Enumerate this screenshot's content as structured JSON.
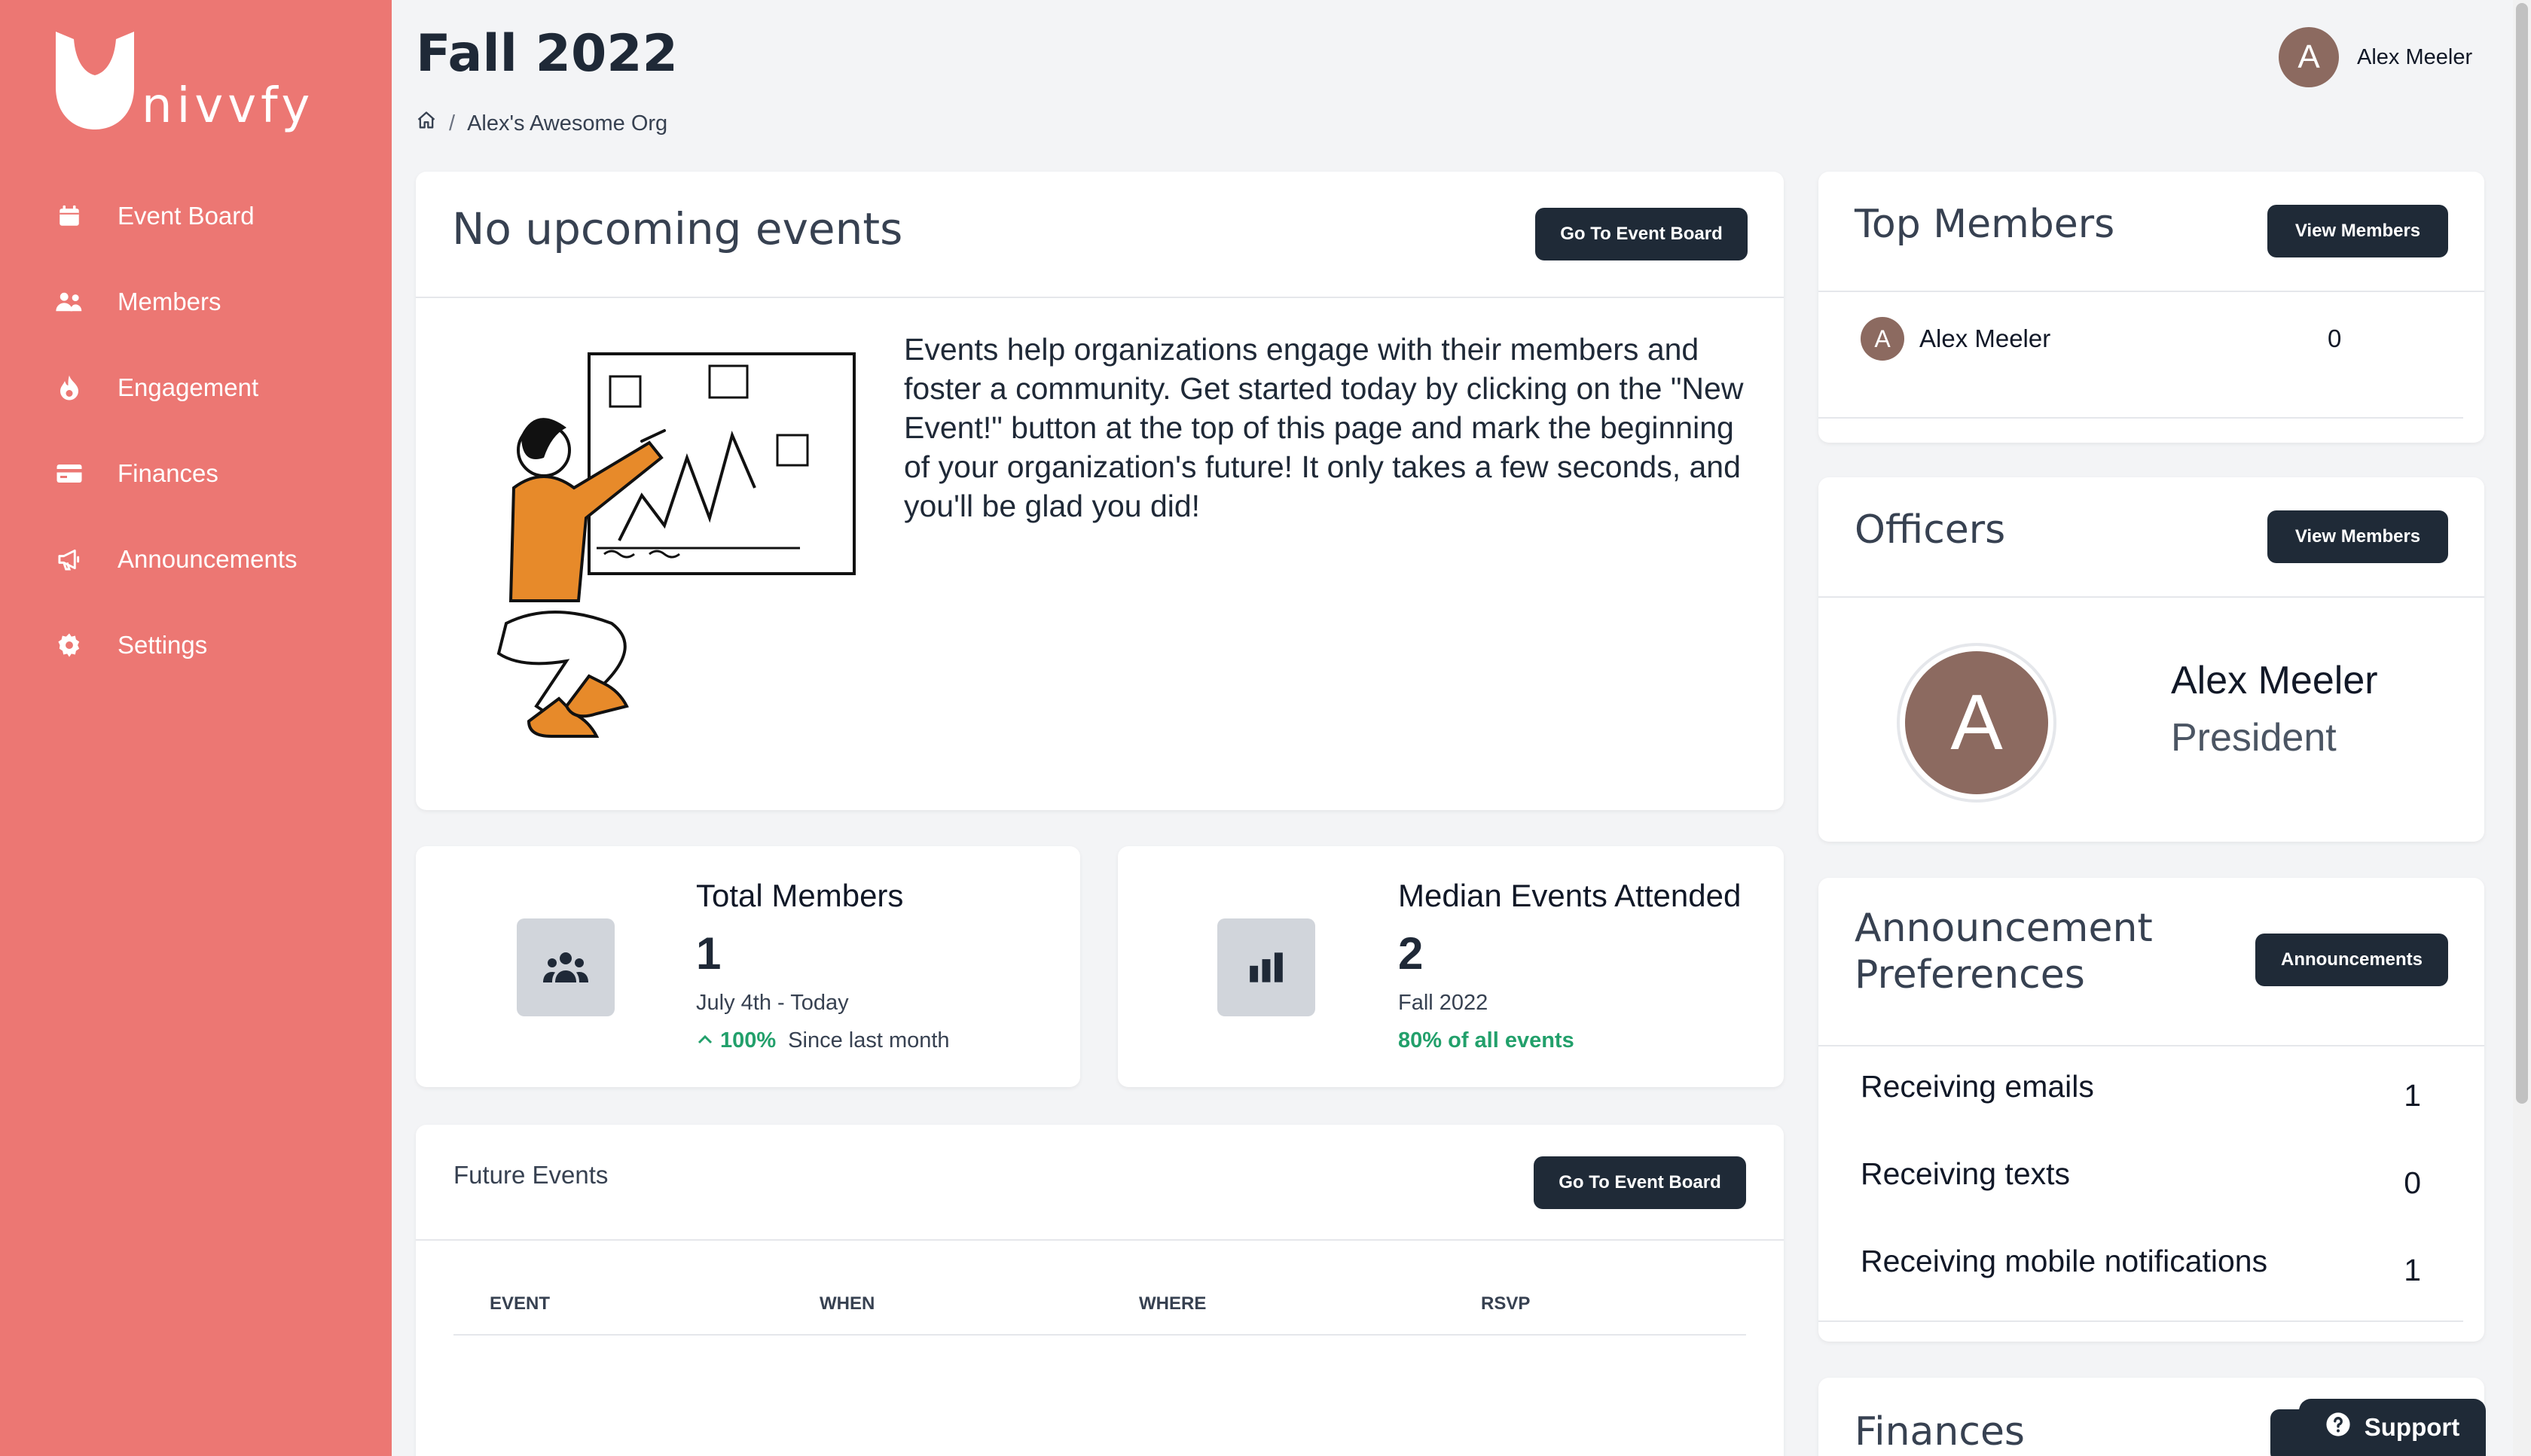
{
  "app": {
    "logo_text": "nivvfy"
  },
  "sidebar": {
    "items": [
      {
        "label": "Event Board",
        "icon": "calendar-icon"
      },
      {
        "label": "Members",
        "icon": "users-icon"
      },
      {
        "label": "Engagement",
        "icon": "fire-icon"
      },
      {
        "label": "Finances",
        "icon": "credit-card-icon"
      },
      {
        "label": "Announcements",
        "icon": "megaphone-icon"
      },
      {
        "label": "Settings",
        "icon": "gear-icon"
      }
    ]
  },
  "header": {
    "title": "Fall 2022",
    "breadcrumb": {
      "org": "Alex's Awesome Org",
      "separator": "/"
    },
    "user": {
      "initial": "A",
      "name": "Alex Meeler"
    }
  },
  "upcoming": {
    "title": "No upcoming events",
    "button": "Go To Event Board",
    "description": "Events help organizations engage with their members and foster a community. Get started today by clicking on the \"New Event!\" button at the top of this page and mark the beginning of your organization's future! It only takes a few seconds, and you'll be glad you did!"
  },
  "stats": {
    "members": {
      "title": "Total Members",
      "value": "1",
      "range": "July 4th - Today",
      "change": "100%",
      "change_label": "Since last month"
    },
    "median": {
      "title": "Median Events Attended",
      "value": "2",
      "range": "Fall 2022",
      "note": "80% of all events"
    }
  },
  "future_events": {
    "title": "Future Events",
    "button": "Go To Event Board",
    "columns": [
      "EVENT",
      "WHEN",
      "WHERE",
      "RSVP"
    ]
  },
  "top_members": {
    "title": "Top Members",
    "button": "View Members",
    "rows": [
      {
        "initial": "A",
        "name": "Alex Meeler",
        "count": "0"
      }
    ]
  },
  "officers": {
    "title": "Officers",
    "button": "View Members",
    "officer": {
      "initial": "A",
      "name": "Alex Meeler",
      "role": "President"
    }
  },
  "announcement_prefs": {
    "title_line1": "Announcement",
    "title_line2": "Preferences",
    "button": "Announcements",
    "rows": [
      {
        "label": "Receiving emails",
        "value": "1"
      },
      {
        "label": "Receiving texts",
        "value": "0"
      },
      {
        "label": "Receiving mobile notifications",
        "value": "1"
      }
    ]
  },
  "finances": {
    "title": "Finances"
  },
  "support": {
    "label": "Support"
  },
  "colors": {
    "sidebar": "#ec7773",
    "button": "#1f2a37",
    "positive": "#22a06b",
    "avatar": "#8c6a60"
  }
}
